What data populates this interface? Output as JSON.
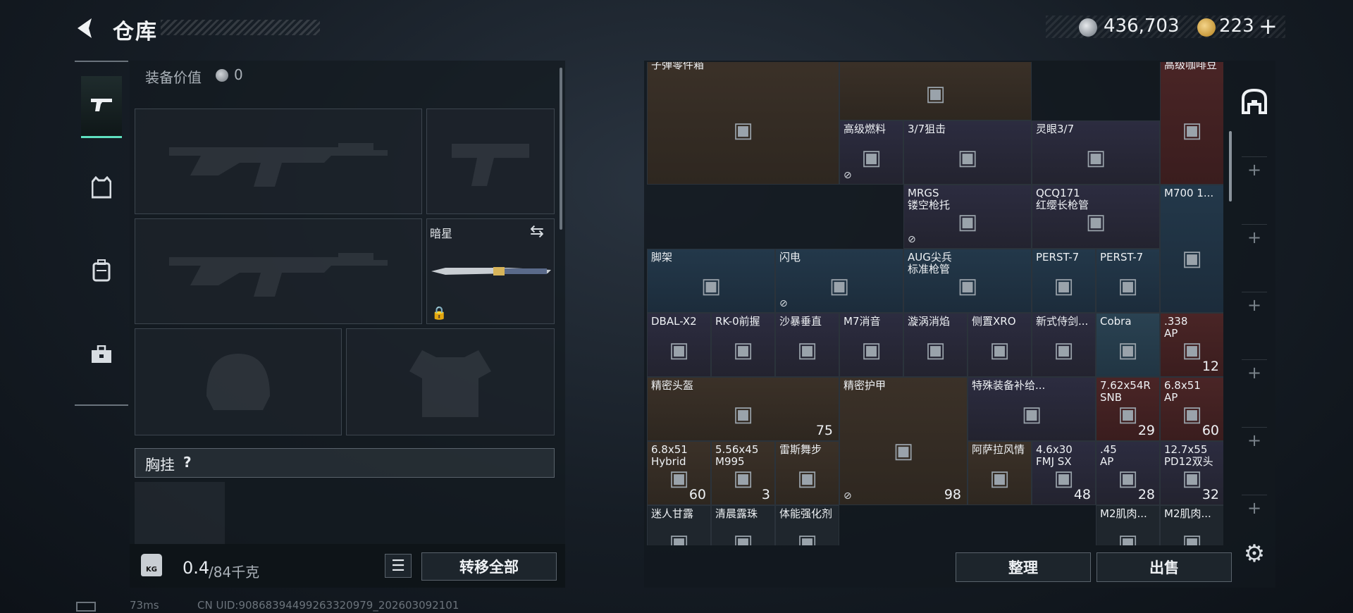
{
  "header": {
    "title": "仓库",
    "silver_amount": "436,703",
    "gold_amount": "223",
    "add_label": "+"
  },
  "loadout": {
    "equipment_value_label": "装备价值",
    "equipment_value": "0",
    "knife_name": "暗星",
    "chest_rig_label": "胸挂",
    "help_label": "?",
    "weight_current": "0.4",
    "weight_max": "/84千克",
    "weight_icon_label": "KG",
    "transfer_all_label": "转移全部"
  },
  "storage": {
    "items": [
      {
        "name": "子弹零件箱",
        "tone": "brown",
        "count": ""
      },
      {
        "name": "",
        "tone": "brown",
        "count": ""
      },
      {
        "name": "高级咖啡豆",
        "tone": "red",
        "count": ""
      },
      {
        "name": "高级燃料",
        "tone": "purple",
        "count": ""
      },
      {
        "name": "3/7狙击",
        "tone": "purple",
        "count": ""
      },
      {
        "name": "灵眼3/7",
        "tone": "purple",
        "count": ""
      },
      {
        "name": "MRGS\n镂空枪托",
        "tone": "purple",
        "count": ""
      },
      {
        "name": "QCQ171\n红缨长枪管",
        "tone": "purple",
        "count": ""
      },
      {
        "name": "M700 1...",
        "tone": "blue",
        "count": ""
      },
      {
        "name": "脚架",
        "tone": "blue",
        "count": ""
      },
      {
        "name": "闪电",
        "tone": "blue",
        "count": ""
      },
      {
        "name": "AUG尖兵\n标准枪管",
        "tone": "blue",
        "count": ""
      },
      {
        "name": "PERST-7",
        "tone": "blue",
        "count": ""
      },
      {
        "name": "PERST-7",
        "tone": "blue",
        "count": ""
      },
      {
        "name": "DBAL-X2",
        "tone": "purple",
        "count": ""
      },
      {
        "name": "RK-0前握",
        "tone": "purple",
        "count": ""
      },
      {
        "name": "沙暴垂直",
        "tone": "purple",
        "count": ""
      },
      {
        "name": "M7消音",
        "tone": "purple",
        "count": ""
      },
      {
        "name": "漩涡消焰",
        "tone": "purple",
        "count": ""
      },
      {
        "name": "侧置XRO",
        "tone": "purple",
        "count": ""
      },
      {
        "name": "新式侍剑...",
        "tone": "purple",
        "count": ""
      },
      {
        "name": "Cobra",
        "tone": "teal",
        "count": ""
      },
      {
        "name": ".338\nAP",
        "tone": "red",
        "count": "12"
      },
      {
        "name": "精密头盔",
        "tone": "brown",
        "count": "75"
      },
      {
        "name": "精密护甲",
        "tone": "brown",
        "count": "98"
      },
      {
        "name": "特殊装备补给...",
        "tone": "purple",
        "count": ""
      },
      {
        "name": "7.62x54R\nSNB",
        "tone": "red",
        "count": "29"
      },
      {
        "name": "6.8x51\nAP",
        "tone": "red",
        "count": "60"
      },
      {
        "name": "6.8x51\nHybrid",
        "tone": "brown",
        "count": "60"
      },
      {
        "name": "5.56x45\nM995",
        "tone": "brown",
        "count": "3"
      },
      {
        "name": "雷斯舞步",
        "tone": "brown",
        "count": ""
      },
      {
        "name": "阿萨拉风情",
        "tone": "brown",
        "count": ""
      },
      {
        "name": "4.6x30\nFMJ SX",
        "tone": "purple",
        "count": "48"
      },
      {
        "name": ".45\nAP",
        "tone": "purple",
        "count": "28"
      },
      {
        "name": "12.7x55\nPD12双头",
        "tone": "purple",
        "count": "32"
      },
      {
        "name": "迷人甘露",
        "tone": "dark",
        "count": ""
      },
      {
        "name": "清晨露珠",
        "tone": "dark",
        "count": ""
      },
      {
        "name": "体能强化剂",
        "tone": "dark",
        "count": ""
      },
      {
        "name": "M2肌肉...",
        "tone": "dark",
        "count": ""
      },
      {
        "name": "M2肌肉...",
        "tone": "dark",
        "count": ""
      }
    ],
    "sort_label": "整理",
    "sell_label": "出售"
  },
  "status": {
    "ping": "73ms",
    "uid": "CN UID:9086839449926332097​9_202603092101"
  },
  "colors": {
    "accent": "#5fe0c0",
    "brown_tier": "#3b3128",
    "blue_tier": "#23384a",
    "red_tier": "#4a2526",
    "purple_tier": "#2c2c40"
  }
}
